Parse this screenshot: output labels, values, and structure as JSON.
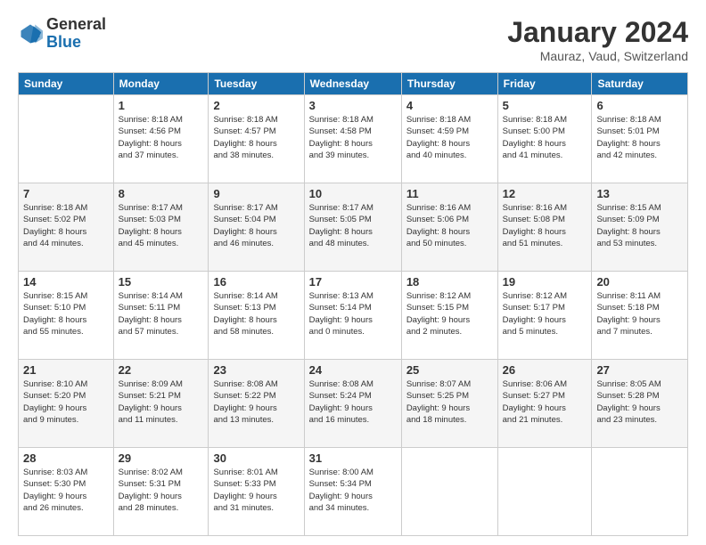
{
  "header": {
    "logo_general": "General",
    "logo_blue": "Blue",
    "month_title": "January 2024",
    "location": "Mauraz, Vaud, Switzerland"
  },
  "days_of_week": [
    "Sunday",
    "Monday",
    "Tuesday",
    "Wednesday",
    "Thursday",
    "Friday",
    "Saturday"
  ],
  "weeks": [
    [
      {
        "day": "",
        "info": ""
      },
      {
        "day": "1",
        "info": "Sunrise: 8:18 AM\nSunset: 4:56 PM\nDaylight: 8 hours\nand 37 minutes."
      },
      {
        "day": "2",
        "info": "Sunrise: 8:18 AM\nSunset: 4:57 PM\nDaylight: 8 hours\nand 38 minutes."
      },
      {
        "day": "3",
        "info": "Sunrise: 8:18 AM\nSunset: 4:58 PM\nDaylight: 8 hours\nand 39 minutes."
      },
      {
        "day": "4",
        "info": "Sunrise: 8:18 AM\nSunset: 4:59 PM\nDaylight: 8 hours\nand 40 minutes."
      },
      {
        "day": "5",
        "info": "Sunrise: 8:18 AM\nSunset: 5:00 PM\nDaylight: 8 hours\nand 41 minutes."
      },
      {
        "day": "6",
        "info": "Sunrise: 8:18 AM\nSunset: 5:01 PM\nDaylight: 8 hours\nand 42 minutes."
      }
    ],
    [
      {
        "day": "7",
        "info": "Sunrise: 8:18 AM\nSunset: 5:02 PM\nDaylight: 8 hours\nand 44 minutes."
      },
      {
        "day": "8",
        "info": "Sunrise: 8:17 AM\nSunset: 5:03 PM\nDaylight: 8 hours\nand 45 minutes."
      },
      {
        "day": "9",
        "info": "Sunrise: 8:17 AM\nSunset: 5:04 PM\nDaylight: 8 hours\nand 46 minutes."
      },
      {
        "day": "10",
        "info": "Sunrise: 8:17 AM\nSunset: 5:05 PM\nDaylight: 8 hours\nand 48 minutes."
      },
      {
        "day": "11",
        "info": "Sunrise: 8:16 AM\nSunset: 5:06 PM\nDaylight: 8 hours\nand 50 minutes."
      },
      {
        "day": "12",
        "info": "Sunrise: 8:16 AM\nSunset: 5:08 PM\nDaylight: 8 hours\nand 51 minutes."
      },
      {
        "day": "13",
        "info": "Sunrise: 8:15 AM\nSunset: 5:09 PM\nDaylight: 8 hours\nand 53 minutes."
      }
    ],
    [
      {
        "day": "14",
        "info": "Sunrise: 8:15 AM\nSunset: 5:10 PM\nDaylight: 8 hours\nand 55 minutes."
      },
      {
        "day": "15",
        "info": "Sunrise: 8:14 AM\nSunset: 5:11 PM\nDaylight: 8 hours\nand 57 minutes."
      },
      {
        "day": "16",
        "info": "Sunrise: 8:14 AM\nSunset: 5:13 PM\nDaylight: 8 hours\nand 58 minutes."
      },
      {
        "day": "17",
        "info": "Sunrise: 8:13 AM\nSunset: 5:14 PM\nDaylight: 9 hours\nand 0 minutes."
      },
      {
        "day": "18",
        "info": "Sunrise: 8:12 AM\nSunset: 5:15 PM\nDaylight: 9 hours\nand 2 minutes."
      },
      {
        "day": "19",
        "info": "Sunrise: 8:12 AM\nSunset: 5:17 PM\nDaylight: 9 hours\nand 5 minutes."
      },
      {
        "day": "20",
        "info": "Sunrise: 8:11 AM\nSunset: 5:18 PM\nDaylight: 9 hours\nand 7 minutes."
      }
    ],
    [
      {
        "day": "21",
        "info": "Sunrise: 8:10 AM\nSunset: 5:20 PM\nDaylight: 9 hours\nand 9 minutes."
      },
      {
        "day": "22",
        "info": "Sunrise: 8:09 AM\nSunset: 5:21 PM\nDaylight: 9 hours\nand 11 minutes."
      },
      {
        "day": "23",
        "info": "Sunrise: 8:08 AM\nSunset: 5:22 PM\nDaylight: 9 hours\nand 13 minutes."
      },
      {
        "day": "24",
        "info": "Sunrise: 8:08 AM\nSunset: 5:24 PM\nDaylight: 9 hours\nand 16 minutes."
      },
      {
        "day": "25",
        "info": "Sunrise: 8:07 AM\nSunset: 5:25 PM\nDaylight: 9 hours\nand 18 minutes."
      },
      {
        "day": "26",
        "info": "Sunrise: 8:06 AM\nSunset: 5:27 PM\nDaylight: 9 hours\nand 21 minutes."
      },
      {
        "day": "27",
        "info": "Sunrise: 8:05 AM\nSunset: 5:28 PM\nDaylight: 9 hours\nand 23 minutes."
      }
    ],
    [
      {
        "day": "28",
        "info": "Sunrise: 8:03 AM\nSunset: 5:30 PM\nDaylight: 9 hours\nand 26 minutes."
      },
      {
        "day": "29",
        "info": "Sunrise: 8:02 AM\nSunset: 5:31 PM\nDaylight: 9 hours\nand 28 minutes."
      },
      {
        "day": "30",
        "info": "Sunrise: 8:01 AM\nSunset: 5:33 PM\nDaylight: 9 hours\nand 31 minutes."
      },
      {
        "day": "31",
        "info": "Sunrise: 8:00 AM\nSunset: 5:34 PM\nDaylight: 9 hours\nand 34 minutes."
      },
      {
        "day": "",
        "info": ""
      },
      {
        "day": "",
        "info": ""
      },
      {
        "day": "",
        "info": ""
      }
    ]
  ]
}
